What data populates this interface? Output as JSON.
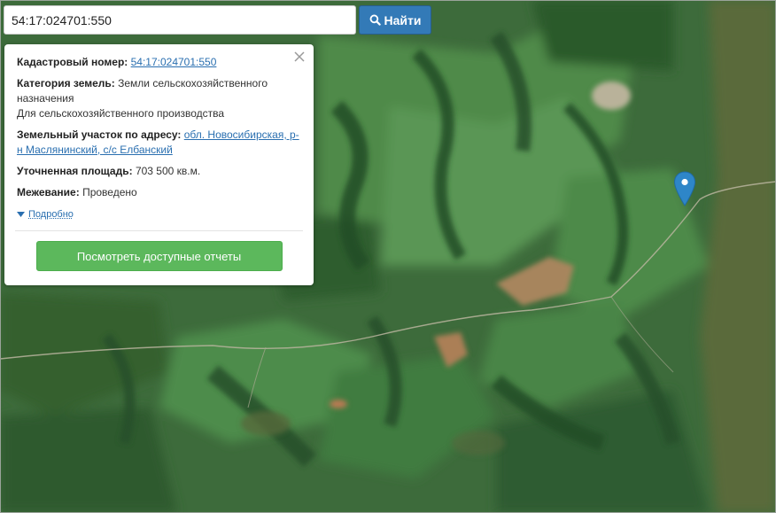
{
  "search": {
    "value": "54:17:024701:550",
    "button_label": "Найти"
  },
  "info": {
    "cadastral_label": "Кадастровый номер:",
    "cadastral_value": "54:17:024701:550",
    "category_label": "Категория земель:",
    "category_value": "Земли сельскохозяйственного назначения",
    "use_value": "Для сельскохозяйственного производства",
    "address_label": "Земельный участок по адресу:",
    "address_value": "обл. Новосибирская, р-н Маслянинский, с/с Елбанский",
    "area_label": "Уточненная площадь:",
    "area_value": "703 500 кв.м.",
    "survey_label": "Межевание:",
    "survey_value": "Проведено",
    "details_label": "Подробно",
    "reports_button": "Посмотреть доступные отчеты"
  },
  "icons": {
    "search": "search-icon",
    "close": "close-icon",
    "details": "caret-down-icon",
    "marker": "map-marker-icon"
  },
  "colors": {
    "search_button": "#337ab7",
    "reports_button": "#5cb85c",
    "link": "#2a6fb0",
    "marker": "#2e86c8"
  }
}
